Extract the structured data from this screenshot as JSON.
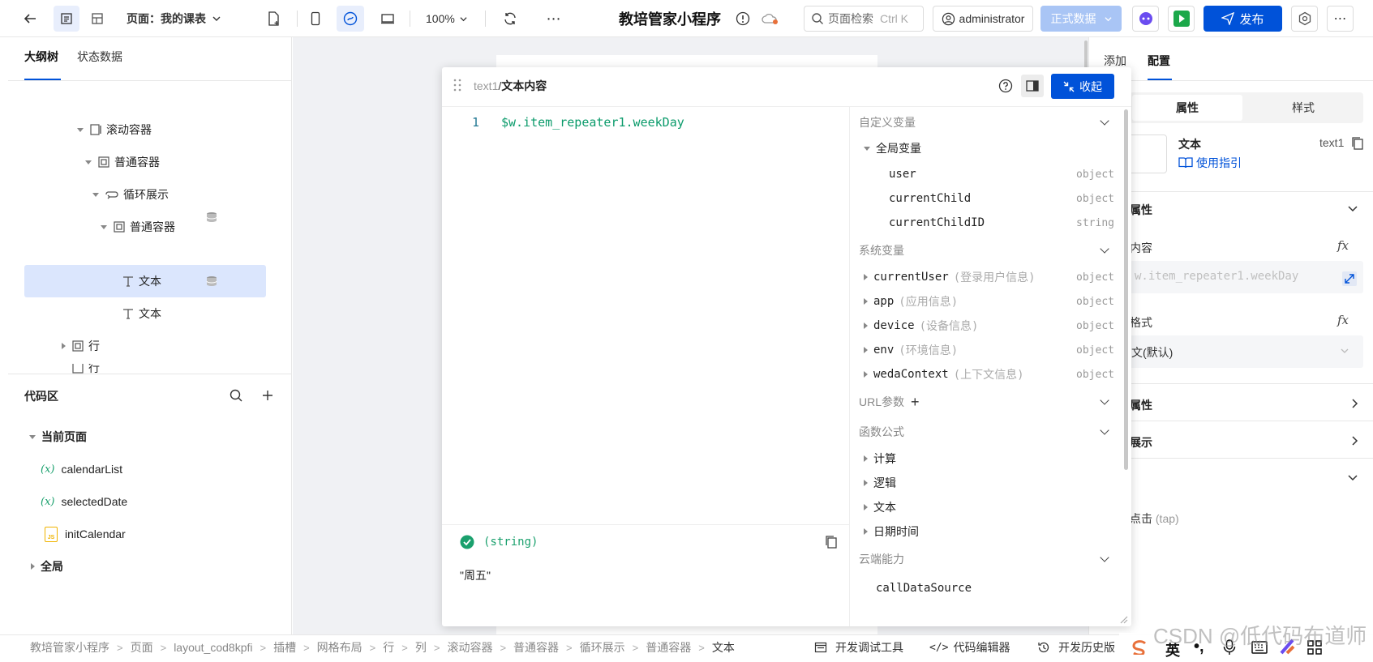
{
  "topbar": {
    "page_label": "页面：我的课表",
    "zoom": "100%",
    "app_title": "教培管家小程序",
    "search_placeholder": "页面检索",
    "search_shortcut": "Ctrl K",
    "user": "administrator",
    "env_label": "正式数据",
    "publish_label": "发布"
  },
  "left": {
    "tabs": [
      "大纲树",
      "状态数据"
    ],
    "tree": [
      "滚动容器",
      "普通容器",
      "循环展示",
      "普通容器",
      "文本",
      "文本",
      "行",
      "行"
    ],
    "code_title": "代码区",
    "current_page": "当前页面",
    "code_items": [
      "calendarList",
      "selectedDate",
      "initCalendar"
    ],
    "var_badge": "(x)",
    "js_badge": "JS",
    "global": "全局"
  },
  "panel": {
    "crumb_prefix": "text1",
    "crumb_sep": "/",
    "crumb_title": "文本内容",
    "collapse_label": "收起",
    "line_no": "1",
    "code": "$w.item_repeater1.weekDay",
    "result_type": "(string)",
    "result_value": "\"周五\"",
    "sections": {
      "custom": "自定义变量",
      "global_vars": "全局变量",
      "system": "系统变量",
      "url": "URL参数",
      "functions": "函数公式",
      "cloud": "云端能力"
    },
    "global_vars": [
      {
        "name": "user",
        "type": "object"
      },
      {
        "name": "currentChild",
        "type": "object"
      },
      {
        "name": "currentChildID",
        "type": "string"
      }
    ],
    "system_vars": [
      {
        "name": "currentUser",
        "desc": "(登录用户信息)",
        "type": "object"
      },
      {
        "name": "app",
        "desc": "(应用信息)",
        "type": "object"
      },
      {
        "name": "device",
        "desc": "(设备信息)",
        "type": "object"
      },
      {
        "name": "env",
        "desc": "(环境信息)",
        "type": "object"
      },
      {
        "name": "wedaContext",
        "desc": "(上下文信息)",
        "type": "object"
      }
    ],
    "functions": [
      "计算",
      "逻辑",
      "文本",
      "日期时间"
    ],
    "cloud_item": "callDataSource"
  },
  "right": {
    "tabs": [
      "添加",
      "配置"
    ],
    "seg": [
      "属性",
      "样式"
    ],
    "comp_name": "文本",
    "comp_id": "text1",
    "guide": "使用指引",
    "props_title": "属性",
    "content_label": "内容",
    "content_value": "w.item_repeater1.weekDay",
    "format_label": "格式",
    "format_value": "文(默认)",
    "fx": "fx",
    "group2": "属性",
    "group3": "展示",
    "event": "点击",
    "event_tap": "(tap)"
  },
  "status": {
    "breadcrumb": [
      "教培管家小程序",
      "页面",
      "layout_cod8kpfi",
      "插槽",
      "网格布局",
      "行",
      "列",
      "滚动容器",
      "普通容器",
      "循环展示",
      "普通容器",
      "文本"
    ],
    "tools": [
      "开发调试工具",
      "代码编辑器",
      "开发历史版"
    ],
    "ime": "英",
    "watermark": "CSDN @低代码布道师"
  },
  "colors": {
    "primary": "#0052d9",
    "code_green": "#0b9b6b",
    "selected_bg": "#dbe6fd"
  }
}
